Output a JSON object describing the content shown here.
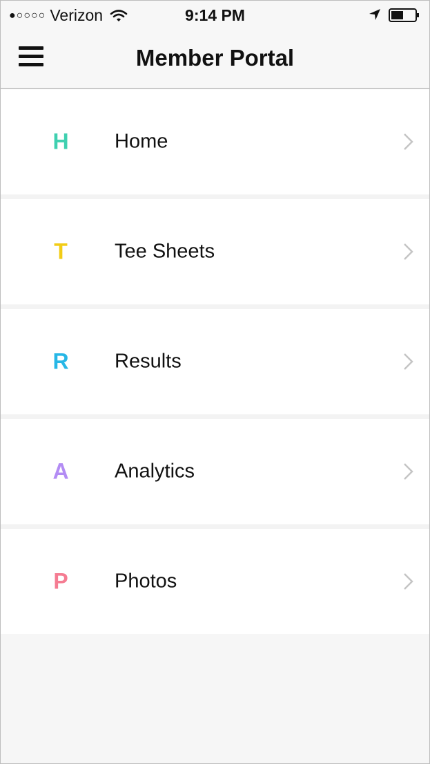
{
  "status_bar": {
    "signal_dots": "●○○○○",
    "carrier": "Verizon",
    "time": "9:14 PM",
    "icons": [
      "wifi-icon",
      "location-arrow-icon",
      "battery-icon"
    ]
  },
  "nav": {
    "title": "Member Portal",
    "menu_icon": "hamburger-icon"
  },
  "menu": {
    "items": [
      {
        "letter": "H",
        "label": "Home",
        "color": "#3fd0b0"
      },
      {
        "letter": "T",
        "label": "Tee Sheets",
        "color": "#f2cc16"
      },
      {
        "letter": "R",
        "label": "Results",
        "color": "#27b7e6"
      },
      {
        "letter": "A",
        "label": "Analytics",
        "color": "#b38cf4"
      },
      {
        "letter": "P",
        "label": "Photos",
        "color": "#f57c92"
      }
    ]
  }
}
